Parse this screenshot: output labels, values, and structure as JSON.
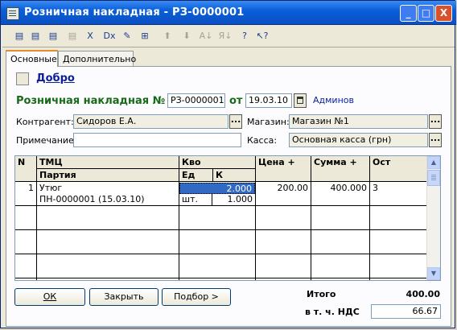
{
  "window": {
    "title": "Розничная накладная - РЗ-0000001",
    "min_label": "_",
    "max_label": "□",
    "close_label": "X"
  },
  "toolbar": {
    "tools": [
      {
        "name": "new-icon",
        "glyph": "▤"
      },
      {
        "name": "copy-new-icon",
        "glyph": "▤"
      },
      {
        "name": "delete-icon",
        "glyph": "▤"
      },
      {
        "name": "disabled-icon",
        "glyph": "▤"
      },
      {
        "name": "mark-delete-icon",
        "glyph": "Ⅹ"
      },
      {
        "name": "delete-row-icon",
        "glyph": "Dx"
      },
      {
        "name": "edit-icon",
        "glyph": "✎"
      },
      {
        "name": "insert-row-icon",
        "glyph": "⊞"
      },
      {
        "name": "move-up-icon",
        "glyph": "⬆"
      },
      {
        "name": "move-down-icon",
        "glyph": "⬇"
      },
      {
        "name": "sort-asc-icon",
        "glyph": "A↓"
      },
      {
        "name": "sort-desc-icon",
        "glyph": "Я↓"
      },
      {
        "name": "help-icon",
        "glyph": "?"
      },
      {
        "name": "what-is-icon",
        "glyph": "↖?"
      }
    ]
  },
  "tabs": [
    {
      "label": "Основные",
      "active": true
    },
    {
      "label": "Дополнительно",
      "active": false
    }
  ],
  "header": {
    "greeting_link": "Добро",
    "doc_label": "Розничная накладная №",
    "doc_number": "РЗ-0000001",
    "from_label": "от",
    "doc_date": "19.03.10",
    "user": "Админов"
  },
  "fields": {
    "contractor_label": "Контрагент:",
    "contractor_value": "Сидоров Е.А.",
    "store_label": "Магазин:",
    "store_value": "Магазин №1",
    "note_label": "Примечание:",
    "note_value": "",
    "cash_label": "Касса:",
    "cash_value": "Основная касса (грн)",
    "dots": "..."
  },
  "table": {
    "headers": {
      "n": "N",
      "item": "ТМЦ",
      "batch": "Партия",
      "qty_group": "Кво",
      "unit": "Ед",
      "k": "К",
      "price": "Цена +",
      "sum": "Сумма +",
      "rest": "Ост"
    },
    "rows": [
      {
        "n": "1",
        "item": "Утюг",
        "batch": "ПН-0000001 (15.03.10)",
        "qty": "2.000",
        "unit": "шт.",
        "k": "1.000",
        "price": "200.00",
        "sum": "400.000",
        "rest": "3"
      }
    ]
  },
  "buttons": {
    "ok": "ОК",
    "close": "Закрыть",
    "pick": "Подбор >"
  },
  "totals": {
    "total_label": "Итого",
    "total_value": "400.00",
    "vat_label": "в т. ч. НДС",
    "vat_value": "66.67"
  }
}
